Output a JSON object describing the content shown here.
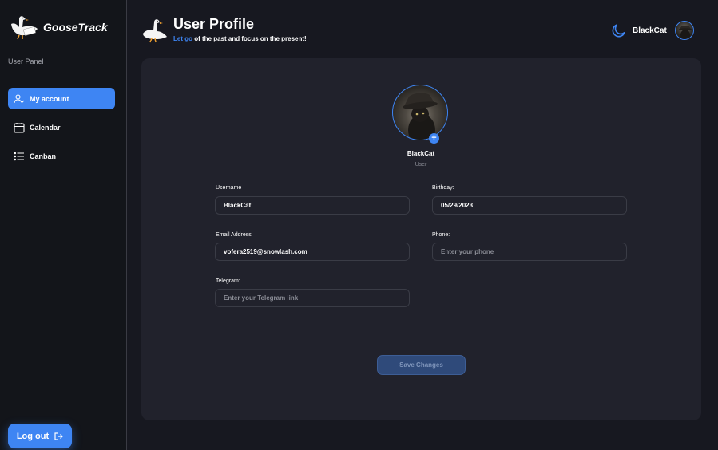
{
  "app": {
    "name_part1": "Goose",
    "name_part2": "Track"
  },
  "sidebar": {
    "panel_label": "User Panel",
    "items": [
      {
        "label": "My account",
        "icon": "user-check-icon",
        "active": true
      },
      {
        "label": "Calendar",
        "icon": "calendar-icon",
        "active": false
      },
      {
        "label": "Canban",
        "icon": "list-icon",
        "active": false
      }
    ],
    "logout_label": "Log out"
  },
  "header": {
    "title": "User Profile",
    "subtitle_highlight": "Let go",
    "subtitle_rest": " of the past and focus on the present!",
    "username": "BlackCat"
  },
  "profile": {
    "name": "BlackCat",
    "role": "User",
    "fields": {
      "username": {
        "label": "Username",
        "value": "BlackCat",
        "placeholder": ""
      },
      "birthday": {
        "label": "Birthday:",
        "value": "05/29/2023",
        "placeholder": ""
      },
      "email": {
        "label": "Email Address",
        "value": "vofera2519@snowlash.com",
        "placeholder": ""
      },
      "phone": {
        "label": "Phone:",
        "value": "",
        "placeholder": "Enter your phone"
      },
      "telegram": {
        "label": "Telegram:",
        "value": "",
        "placeholder": "Enter your Telegram link"
      }
    },
    "save_label": "Save Changes",
    "add_avatar_label": "+"
  },
  "colors": {
    "accent": "#3e85f3",
    "background": "#171820",
    "card": "#21222c",
    "sidebar": "#13151a"
  }
}
